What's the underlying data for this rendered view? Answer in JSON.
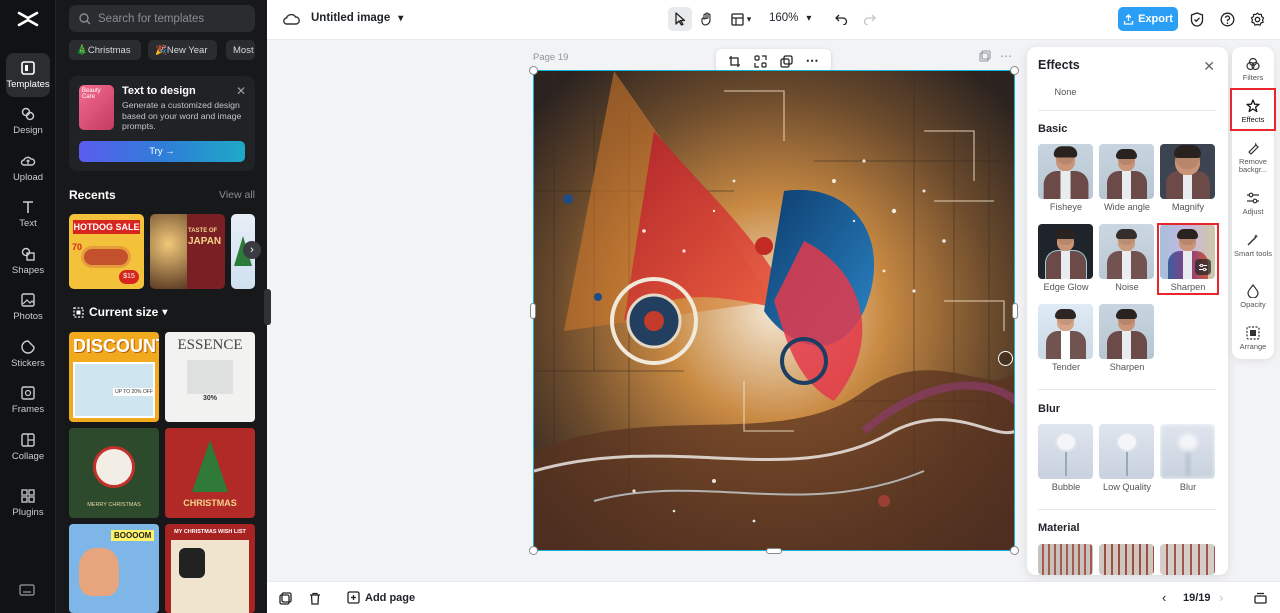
{
  "rail": {
    "items": [
      {
        "label": "Templates",
        "icon": "templates-icon"
      },
      {
        "label": "Design",
        "icon": "design-icon"
      },
      {
        "label": "Upload",
        "icon": "upload-icon"
      },
      {
        "label": "Text",
        "icon": "text-icon"
      },
      {
        "label": "Shapes",
        "icon": "shapes-icon"
      },
      {
        "label": "Photos",
        "icon": "photos-icon"
      },
      {
        "label": "Stickers",
        "icon": "stickers-icon"
      },
      {
        "label": "Frames",
        "icon": "frames-icon"
      },
      {
        "label": "Collage",
        "icon": "collage-icon"
      },
      {
        "label": "Plugins",
        "icon": "plugins-icon"
      }
    ]
  },
  "panel": {
    "search_placeholder": "Search for templates",
    "chips": [
      "🎄Christmas",
      "🎉New Year",
      "Most"
    ],
    "text_to_design": {
      "title": "Text to design",
      "description": "Generate a customized design based on your word and image prompts.",
      "try_label": "Try →",
      "thumb_text": "Beauty Care"
    },
    "recents_title": "Recents",
    "view_all": "View all",
    "recents": [
      {
        "line1": "HOTDOG SALE",
        "line2": "70",
        "line3": "$15"
      },
      {
        "line1": "TASTE OF",
        "line2": "JAPAN"
      },
      {
        "line1": ""
      }
    ],
    "current_size_label": "Current size",
    "templates": [
      {
        "title": "DISCOUNT",
        "sub": "UP TO 20% OFF"
      },
      {
        "title": "ESSENCE",
        "sub": "30%"
      },
      {
        "title": "MERRY CHRISTMAS"
      },
      {
        "title": "CHRISTMAS"
      },
      {
        "title": "BOOOOM"
      },
      {
        "title": "MY CHRISTMAS WISH LIST"
      }
    ]
  },
  "topbar": {
    "doc_title": "Untitled image",
    "zoom": "160%",
    "export_label": "Export"
  },
  "canvas": {
    "page_label": "Page 19"
  },
  "effects": {
    "title": "Effects",
    "none_label": "None",
    "sections": [
      {
        "title": "Basic",
        "items": [
          "Fisheye",
          "Wide angle",
          "Magnify",
          "Edge Glow",
          "Noise",
          "Sharpen",
          "Tender",
          "Sharpen"
        ]
      },
      {
        "title": "Blur",
        "items": [
          "Bubble",
          "Low Quality",
          "Blur"
        ]
      },
      {
        "title": "Material",
        "items": []
      }
    ],
    "selected": "Sharpen"
  },
  "right_tools": [
    {
      "label": "Filters",
      "icon": "filters-icon"
    },
    {
      "label": "Effects",
      "icon": "effects-icon"
    },
    {
      "label": "Remove backgr...",
      "icon": "remove-background-icon"
    },
    {
      "label": "Adjust",
      "icon": "adjust-icon"
    },
    {
      "label": "Smart tools",
      "icon": "smart-tools-icon"
    },
    {
      "label": "Opacity",
      "icon": "opacity-icon"
    },
    {
      "label": "Arrange",
      "icon": "arrange-icon"
    }
  ],
  "bottombar": {
    "add_page_label": "Add page",
    "page_counter": "19/19"
  },
  "colors": {
    "accent": "#2a9ff5",
    "highlight": "#e8262b",
    "selection": "#16b2d8"
  }
}
